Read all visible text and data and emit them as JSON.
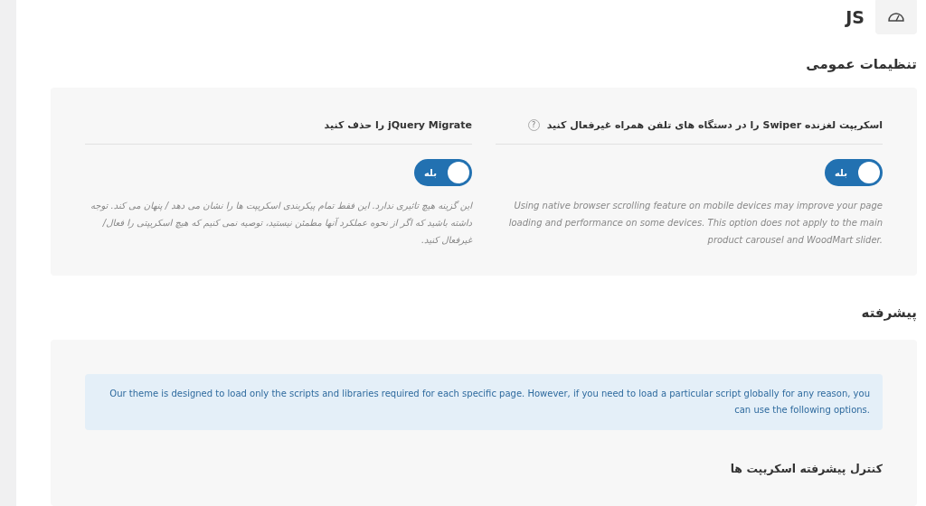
{
  "header": {
    "title": "JS"
  },
  "sections": [
    {
      "title": "تنظيمات عمومی",
      "options": [
        {
          "label": "اسکریپت لغزنده Swiper را در دستگاه های تلفن همراه غیرفعال کنید",
          "help": "?",
          "switch_label": "بله",
          "on": true,
          "description": "Using native browser scrolling feature on mobile devices may improve your page loading and performance on some devices. This option does not apply to the main product carousel and WoodMart slider."
        },
        {
          "label": "jQuery Migrate را حذف کنید",
          "switch_label": "بله",
          "on": true,
          "description": "این گزینه هیچ تاثیری ندارد. این فقط تمام پیکربندی اسکریپت ها را نشان می دهد / پنهان می کند. توجه داشته باشید که اگر از نحوه عملکرد آنها مطمئن نیستید، توصیه نمی کنیم که هیچ اسکریپتی را فعال/غیرفعال کنید."
        }
      ]
    },
    {
      "title": "پیشرفته",
      "notice": "Our theme is designed to load only the scripts and libraries required for each specific page. However, if you need to load a particular script globally for any reason, you can use the following options.",
      "subtitle": "کنترل پیشرفته اسکریپت ها"
    }
  ]
}
